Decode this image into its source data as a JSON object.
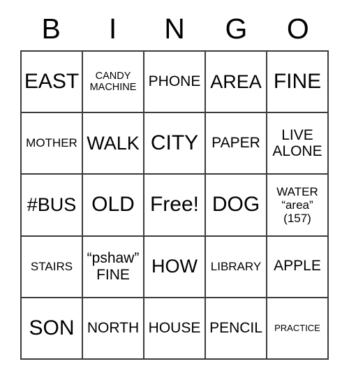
{
  "card": {
    "title": "BINGO",
    "header_letters": [
      "B",
      "I",
      "N",
      "G",
      "O"
    ],
    "colors": {
      "background": "#ffffff",
      "border": "#3b3b3b",
      "text": "#000000"
    },
    "free_space": {
      "row": 3,
      "column": 3,
      "label": "Free!"
    },
    "rows": [
      [
        {
          "text": "EAST",
          "size": "xl"
        },
        {
          "text": "CANDY\nMACHINE",
          "size": "xs"
        },
        {
          "text": "PHONE",
          "size": "md"
        },
        {
          "text": "AREA",
          "size": "lg"
        },
        {
          "text": "FINE",
          "size": "xl"
        }
      ],
      [
        {
          "text": "MOTHER",
          "size": "sm"
        },
        {
          "text": "WALK",
          "size": "lg"
        },
        {
          "text": "CITY",
          "size": "xl"
        },
        {
          "text": "PAPER",
          "size": "md"
        },
        {
          "text": "LIVE\nALONE",
          "size": "md"
        }
      ],
      [
        {
          "text": "#BUS",
          "size": "lg"
        },
        {
          "text": "OLD",
          "size": "xl"
        },
        {
          "text": "Free!",
          "size": "xl"
        },
        {
          "text": "DOG",
          "size": "xl"
        },
        {
          "text": "WATER\n“area”\n(157)",
          "size": "sm"
        }
      ],
      [
        {
          "text": "STAIRS",
          "size": "sm"
        },
        {
          "text": "“pshaw”\nFINE",
          "size": "md"
        },
        {
          "text": "HOW",
          "size": "lg"
        },
        {
          "text": "LIBRARY",
          "size": "sm"
        },
        {
          "text": "APPLE",
          "size": "md"
        }
      ],
      [
        {
          "text": "SON",
          "size": "xl"
        },
        {
          "text": "NORTH",
          "size": "md"
        },
        {
          "text": "HOUSE",
          "size": "md"
        },
        {
          "text": "PENCIL",
          "size": "md"
        },
        {
          "text": "PRACTICE",
          "size": "xxs"
        }
      ]
    ]
  }
}
